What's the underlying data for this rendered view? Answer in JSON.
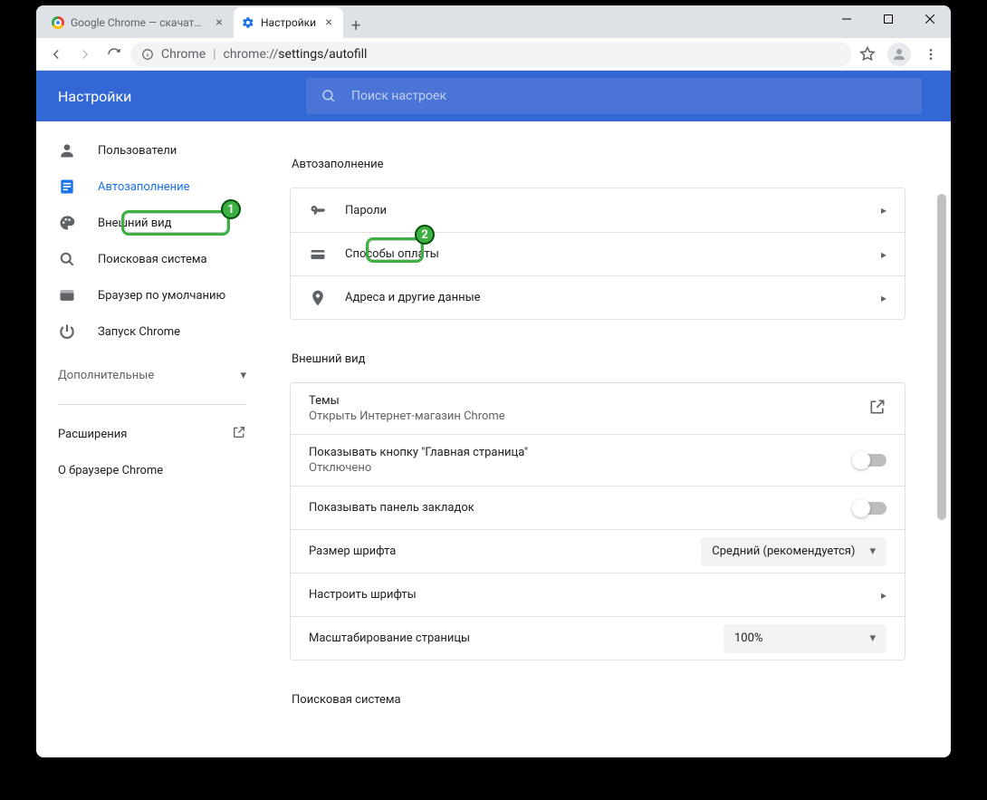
{
  "window": {
    "tabs": [
      {
        "title": "Google Chrome — скачать бесп",
        "active": false,
        "favicon": "chrome"
      },
      {
        "title": "Настройки",
        "active": true,
        "favicon": "gear"
      }
    ],
    "address": {
      "scheme_label": "Chrome",
      "url_prefix": "chrome://",
      "url_path": "settings/autofill"
    }
  },
  "header": {
    "title": "Настройки",
    "search_placeholder": "Поиск настроек"
  },
  "sidebar": {
    "items": [
      {
        "icon": "person",
        "label": "Пользователи"
      },
      {
        "icon": "form",
        "label": "Автозаполнение",
        "selected": true
      },
      {
        "icon": "palette",
        "label": "Внешний вид"
      },
      {
        "icon": "search",
        "label": "Поисковая система"
      },
      {
        "icon": "browser",
        "label": "Браузер по умолчанию"
      },
      {
        "icon": "power",
        "label": "Запуск Chrome"
      }
    ],
    "advanced_label": "Дополнительные",
    "extensions_label": "Расширения",
    "about_label": "О браузере Chrome"
  },
  "sections": {
    "autofill": {
      "title": "Автозаполнение",
      "items": [
        {
          "icon": "key",
          "label": "Пароли"
        },
        {
          "icon": "card",
          "label": "Способы оплаты"
        },
        {
          "icon": "place",
          "label": "Адреса и другие данные"
        }
      ]
    },
    "appearance": {
      "title": "Внешний вид",
      "themes_label": "Темы",
      "themes_sub": "Открыть Интернет-магазин Chrome",
      "home_button_label": "Показывать кнопку \"Главная страница\"",
      "home_button_state": "Отключено",
      "bookmarks_bar_label": "Показывать панель закладок",
      "font_size_label": "Размер шрифта",
      "font_size_value": "Средний (рекомендуется)",
      "customize_fonts_label": "Настроить шрифты",
      "page_zoom_label": "Масштабирование страницы",
      "page_zoom_value": "100%"
    },
    "search_engine": {
      "title": "Поисковая система"
    }
  },
  "callouts": {
    "b1": "1",
    "b2": "2"
  }
}
